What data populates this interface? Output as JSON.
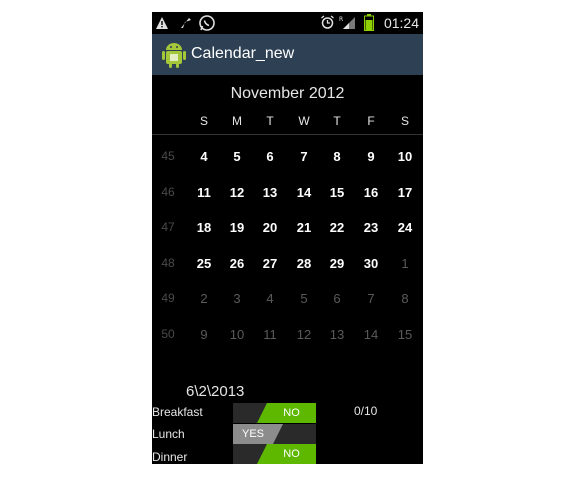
{
  "status_bar": {
    "time": "01:24",
    "icons": [
      "warning-icon",
      "flag-icon",
      "whatsapp-icon",
      "alarm-icon",
      "signal-icon",
      "battery-icon"
    ]
  },
  "app": {
    "title": "Calendar_new",
    "title_bar_color": "#2d4054"
  },
  "calendar": {
    "month_title": "November 2012",
    "weekdays": [
      "S",
      "M",
      "T",
      "W",
      "T",
      "F",
      "S"
    ],
    "weeks": [
      {
        "week_no": "45",
        "days": [
          {
            "d": "4",
            "cur": true
          },
          {
            "d": "5",
            "cur": true
          },
          {
            "d": "6",
            "cur": true
          },
          {
            "d": "7",
            "cur": true
          },
          {
            "d": "8",
            "cur": true
          },
          {
            "d": "9",
            "cur": true
          },
          {
            "d": "10",
            "cur": true
          }
        ]
      },
      {
        "week_no": "46",
        "days": [
          {
            "d": "11",
            "cur": true
          },
          {
            "d": "12",
            "cur": true
          },
          {
            "d": "13",
            "cur": true
          },
          {
            "d": "14",
            "cur": true
          },
          {
            "d": "15",
            "cur": true
          },
          {
            "d": "16",
            "cur": true
          },
          {
            "d": "17",
            "cur": true
          }
        ]
      },
      {
        "week_no": "47",
        "days": [
          {
            "d": "18",
            "cur": true
          },
          {
            "d": "19",
            "cur": true
          },
          {
            "d": "20",
            "cur": true
          },
          {
            "d": "21",
            "cur": true
          },
          {
            "d": "22",
            "cur": true
          },
          {
            "d": "23",
            "cur": true
          },
          {
            "d": "24",
            "cur": true
          }
        ]
      },
      {
        "week_no": "48",
        "days": [
          {
            "d": "25",
            "cur": true
          },
          {
            "d": "26",
            "cur": true
          },
          {
            "d": "27",
            "cur": true
          },
          {
            "d": "28",
            "cur": true
          },
          {
            "d": "29",
            "cur": true
          },
          {
            "d": "30",
            "cur": true
          },
          {
            "d": "1",
            "cur": false
          }
        ]
      },
      {
        "week_no": "49",
        "days": [
          {
            "d": "2",
            "cur": false
          },
          {
            "d": "3",
            "cur": false
          },
          {
            "d": "4",
            "cur": false
          },
          {
            "d": "5",
            "cur": false
          },
          {
            "d": "6",
            "cur": false
          },
          {
            "d": "7",
            "cur": false
          },
          {
            "d": "8",
            "cur": false
          }
        ]
      },
      {
        "week_no": "50",
        "days": [
          {
            "d": "9",
            "cur": false
          },
          {
            "d": "10",
            "cur": false
          },
          {
            "d": "11",
            "cur": false
          },
          {
            "d": "12",
            "cur": false
          },
          {
            "d": "13",
            "cur": false
          },
          {
            "d": "14",
            "cur": false
          },
          {
            "d": "15",
            "cur": false
          }
        ]
      }
    ]
  },
  "selected_date": "6\\2\\2013",
  "meals": {
    "breakfast": {
      "label": "Breakfast",
      "state": "NO"
    },
    "lunch": {
      "label": "Lunch",
      "state": "YES"
    },
    "dinner": {
      "label": "Dinner",
      "state": "NO"
    }
  },
  "score": "0/10",
  "colors": {
    "toggle_on": "#5eb800",
    "toggle_yes": "#8c8c8c"
  }
}
